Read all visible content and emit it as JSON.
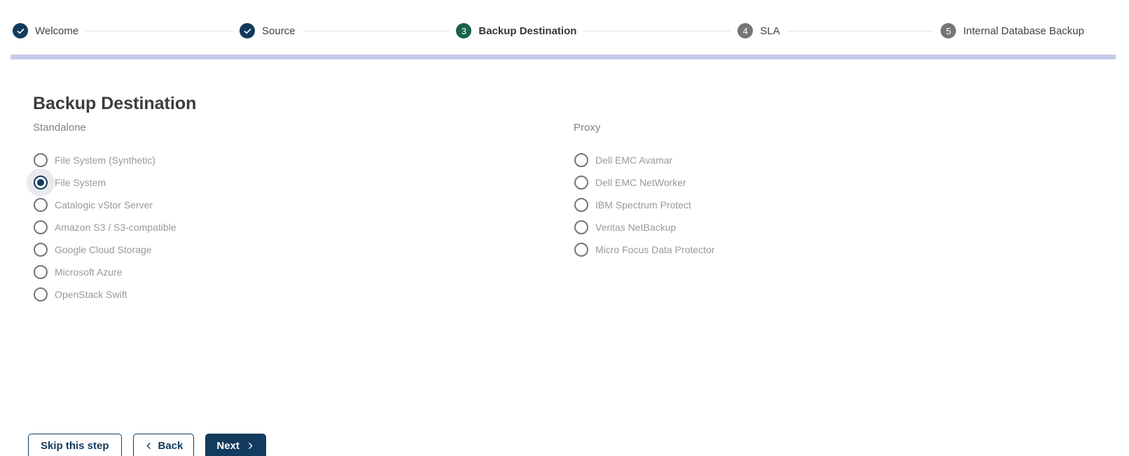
{
  "stepper": {
    "steps": [
      {
        "label": "Welcome",
        "state": "completed",
        "icon": "check-icon"
      },
      {
        "label": "Source",
        "state": "completed",
        "icon": "check-icon"
      },
      {
        "number": "3",
        "label": "Backup Destination",
        "state": "active"
      },
      {
        "number": "4",
        "label": "SLA",
        "state": "upcoming"
      },
      {
        "number": "5",
        "label": "Internal Database Backup",
        "state": "upcoming"
      }
    ]
  },
  "page": {
    "title": "Backup Destination"
  },
  "groups": [
    {
      "label": "Standalone",
      "options": [
        {
          "label": "File System (Synthetic)",
          "selected": false
        },
        {
          "label": "File System",
          "selected": true
        },
        {
          "label": "Catalogic vStor Server",
          "selected": false
        },
        {
          "label": "Amazon S3 / S3-compatible",
          "selected": false
        },
        {
          "label": "Google Cloud Storage",
          "selected": false
        },
        {
          "label": "Microsoft Azure",
          "selected": false
        },
        {
          "label": "OpenStack Swift",
          "selected": false
        }
      ]
    },
    {
      "label": "Proxy",
      "options": [
        {
          "label": "Dell EMC Avamar",
          "selected": false
        },
        {
          "label": "Dell EMC NetWorker",
          "selected": false
        },
        {
          "label": "IBM Spectrum Protect",
          "selected": false
        },
        {
          "label": "Veritas NetBackup",
          "selected": false
        },
        {
          "label": "Micro Focus Data Protector",
          "selected": false
        }
      ]
    }
  ],
  "actions": {
    "skip": "Skip this step",
    "back": "Back",
    "next": "Next"
  },
  "colors": {
    "navy": "#123b5d",
    "green": "#19624c",
    "step_gray": "#757575",
    "progress_bar": "#c5c9e9",
    "connector": "#e2e2e2"
  }
}
